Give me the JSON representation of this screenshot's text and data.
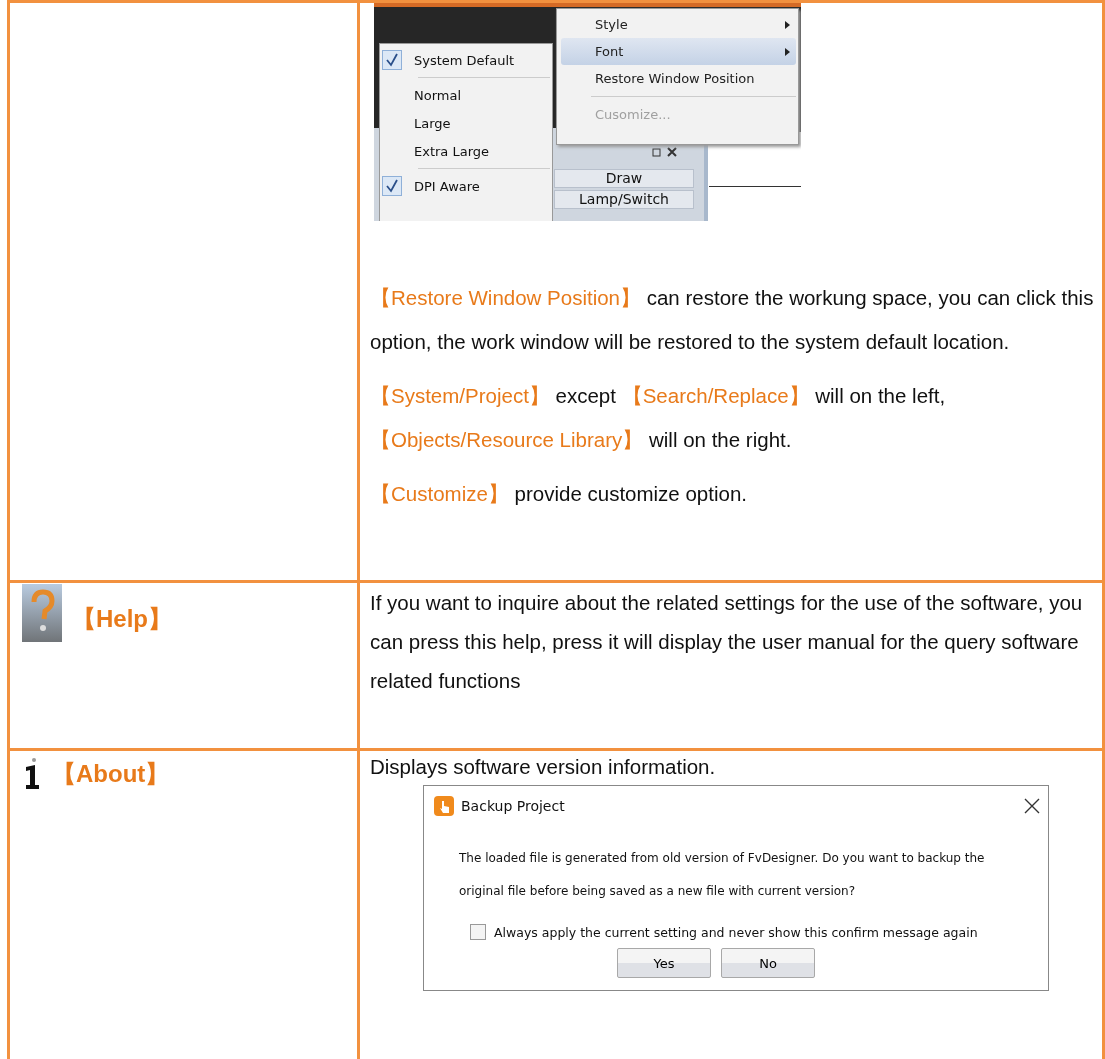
{
  "rows": [
    {
      "kind": "plain",
      "screenshot": {
        "menu": [
          {
            "kind": "item",
            "label": "Style",
            "submenu": true,
            "highlighted": false,
            "disabled": false
          },
          {
            "kind": "item",
            "label": "Font",
            "submenu": true,
            "highlighted": true,
            "disabled": false
          },
          {
            "kind": "item",
            "label": "Restore Window Position",
            "submenu": false,
            "highlighted": false,
            "disabled": false
          },
          {
            "kind": "separator"
          },
          {
            "kind": "item",
            "label": "Cusomize...",
            "submenu": false,
            "highlighted": false,
            "disabled": true
          }
        ],
        "submenu": [
          {
            "kind": "item",
            "label": "System Default",
            "checked": true
          },
          {
            "kind": "separator"
          },
          {
            "kind": "item",
            "label": "Normal",
            "checked": false
          },
          {
            "kind": "item",
            "label": "Large",
            "checked": false
          },
          {
            "kind": "item",
            "label": "Extra Large",
            "checked": false
          },
          {
            "kind": "separator"
          },
          {
            "kind": "item",
            "label": "DPI Aware",
            "checked": true
          }
        ],
        "panel_items": [
          "Draw",
          "Lamp/Switch"
        ]
      },
      "paragraphs": [
        [
          {
            "kind": "option",
            "text": "【Restore Window Position】"
          },
          {
            "kind": "plain",
            "text": "can restore the workung space, you can click this option, the work window will be restored to the system default location."
          }
        ],
        [
          {
            "kind": "option",
            "text": "【System/Project】"
          },
          {
            "kind": "plain",
            "text": "except"
          },
          {
            "kind": "option",
            "text": "【Search/Replace】"
          },
          {
            "kind": "plain",
            "text": "will on the left,"
          },
          {
            "kind": "option",
            "text": "【Objects/Resource Library】"
          },
          {
            "kind": "plain",
            "text": "will on the right."
          }
        ],
        [
          {
            "kind": "option",
            "text": "【Customize】"
          },
          {
            "kind": "plain",
            "text": "provide customize option."
          }
        ]
      ]
    },
    {
      "name": "【Help】",
      "kind": "help",
      "paragraphs": [
        [
          {
            "kind": "plain",
            "text": "If you want to inquire about the related settings for the use of the software, you can press this help, press it will display the user manual for the query software related functions"
          }
        ]
      ]
    },
    {
      "name": "【About】",
      "kind": "about",
      "paragraphs": [
        [
          {
            "kind": "plain",
            "text": "Displays software version information."
          }
        ]
      ],
      "dialog": {
        "title": "Backup Project",
        "message": "The loaded file is generated from old version of FvDesigner. Do you want to backup the original file before being saved as a new file with current version?",
        "checkbox": {
          "label": "Always apply the current setting and never show this confirm message again",
          "checked": false
        },
        "buttons": [
          "Yes",
          "No"
        ]
      }
    }
  ]
}
